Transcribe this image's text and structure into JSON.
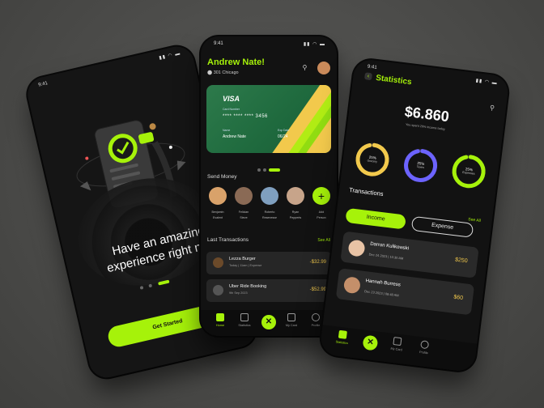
{
  "colors": {
    "accent": "#a6f20a",
    "amount": "#f2c94c",
    "background": "#4a4a48",
    "phone": "#121212"
  },
  "status_bar": {
    "time": "9:41",
    "icons": "▮▮ ◠ ▬"
  },
  "onboarding": {
    "headline": "Have an amazing experience right now",
    "button_label": "Get Started",
    "icons": [
      "check-icon",
      "phone-illustration"
    ]
  },
  "home": {
    "user_name": "Andrew Nate!",
    "location": "301 Chicago",
    "card": {
      "brand": "VISA",
      "number_label": "Card Number",
      "number": "**** **** **** 3456",
      "name_label": "Name",
      "name": "Andrew Nate",
      "exp_label": "Exp Date",
      "exp": "06/24"
    },
    "send_money_title": "Send Money",
    "contacts": [
      {
        "first": "Benjamin",
        "last": "Evalent"
      },
      {
        "first": "Felician",
        "last": "Steve"
      },
      {
        "first": "Roberto",
        "last": "Resenesse"
      },
      {
        "first": "Ryan",
        "last": "Pepperts"
      },
      {
        "first": "Add",
        "last": "Person"
      }
    ],
    "last_tx_title": "Last Transactions",
    "see_all": "See All",
    "transactions": [
      {
        "title": "Lezza Burger",
        "sub": "Today | 11am | Expense",
        "amount": "-$32.99"
      },
      {
        "title": "Uber Ride Booking",
        "sub": "9th Sep 2023",
        "amount": "-$52.99"
      }
    ],
    "nav": [
      "Home",
      "Statistics",
      "My Card",
      "Profile"
    ]
  },
  "stats": {
    "title": "Statistics",
    "total": "$6.860",
    "spent_note": "You spent 20% income today",
    "rings": [
      {
        "pct": "25%",
        "label": "Grocery",
        "color": "#f2c94c",
        "value": 0.25
      },
      {
        "pct": "25%",
        "label": "Taxes",
        "color": "#6c63ff",
        "value": 0.25
      },
      {
        "pct": "25%",
        "label": "Expenses",
        "color": "#a6f20a",
        "value": 0.25
      }
    ],
    "transactions_title": "Transactions",
    "see_all": "See All",
    "tab_income": "Income",
    "tab_expense": "Expense",
    "people": [
      {
        "name": "Darron Kulikowski",
        "date": "Dec 24 2023  |  10:30 AM",
        "amount": "$250"
      },
      {
        "name": "Hannah Burress",
        "date": "Dec 23 2023  |  08:48 AM",
        "amount": "$60"
      }
    ],
    "nav": [
      "Statistics",
      "My Card",
      "Profile"
    ]
  }
}
